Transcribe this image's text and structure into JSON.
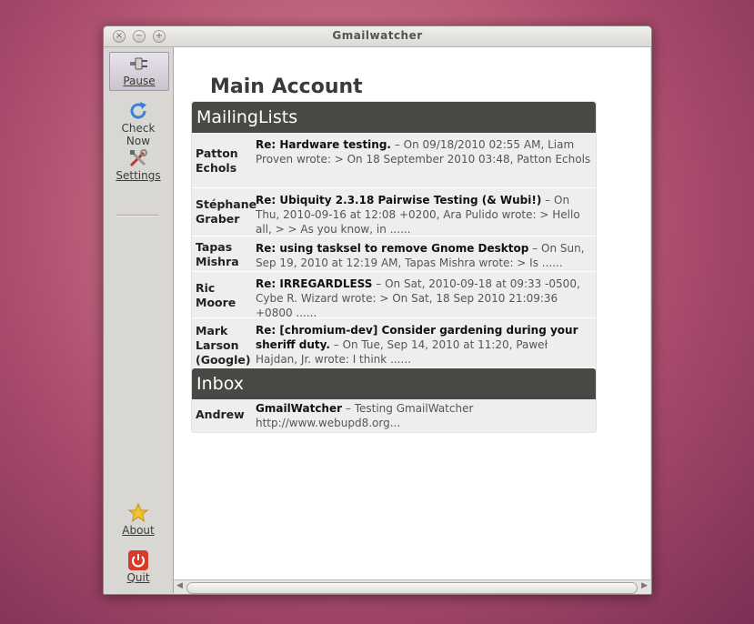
{
  "window": {
    "title": "Gmailwatcher"
  },
  "toolbar": {
    "pause_label": "Pause",
    "check_now_label": "Check Now",
    "settings_label": "Settings",
    "about_label": "About",
    "quit_label": "Quit"
  },
  "account": {
    "title": "Main Account"
  },
  "sections": [
    {
      "name": "MailingLists",
      "messages": [
        {
          "sender": "Patton Echols",
          "subject": "Re: Hardware testing.",
          "preview": "On 09/18/2010 02:55 AM, Liam Proven wrote: > On 18 September 2010 03:48, Patton Echols"
        },
        {
          "sender": "Stéphane Graber",
          "subject": "Re: Ubiquity 2.3.18 Pairwise Testing (& Wubi!)",
          "preview": "On Thu, 2010-09-16 at 12:08 +0200, Ara Pulido wrote: > Hello all, > > As you know, in ......"
        },
        {
          "sender": "Tapas Mishra",
          "subject": "Re: using tasksel to remove Gnome Desktop",
          "preview": "On Sun, Sep 19, 2010 at 12:19 AM, Tapas Mishra wrote: > Is ......"
        },
        {
          "sender": "Ric Moore",
          "subject": "Re: IRREGARDLESS",
          "preview": "On Sat, 2010-09-18 at 09:33 -0500, Cybe R. Wizard wrote: > On Sat, 18 Sep 2010 21:09:36 +0800 ......"
        },
        {
          "sender": "Mark Larson (Google)",
          "subject": "Re: [chromium-dev] Consider gardening during your sheriff duty.",
          "preview": "On Tue, Sep 14, 2010 at 11:20, Paweł Hajdan, Jr. wrote: I think ......"
        }
      ]
    },
    {
      "name": "Inbox",
      "messages": [
        {
          "sender": "Andrew",
          "subject": "GmailWatcher",
          "preview": "Testing GmailWatcher http://www.webupd8.org..."
        }
      ]
    }
  ],
  "separator": "–",
  "icons": {
    "pause": "pause-plug-icon",
    "check_now": "refresh-icon",
    "settings": "tools-icon",
    "about": "star-icon",
    "quit": "power-icon"
  }
}
